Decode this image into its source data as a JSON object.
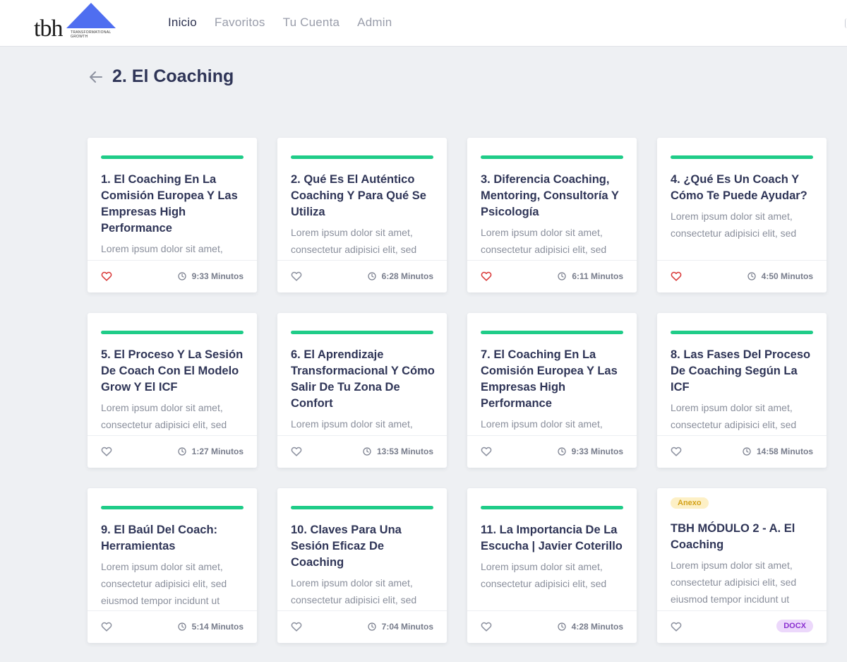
{
  "header": {
    "logo_text": "tbh",
    "logo_tagline": "TRANSFORMATIONAL GROWTH",
    "nav": [
      "Inicio",
      "Favoritos",
      "Tu Cuenta",
      "Admin"
    ]
  },
  "page": {
    "title": "2. El Coaching"
  },
  "colors": {
    "progress": "#1fcc88",
    "heart_active": "#d93838",
    "title": "#2f3557"
  },
  "cards": [
    {
      "title": "1. El Coaching En La Comisión Europea Y Las Empresas High Performance",
      "desc": "Lorem ipsum dolor sit amet,",
      "duration": "9:33 Minutos",
      "favorite": true
    },
    {
      "title": "2. Qué Es El Auténtico Coaching Y Para Qué Se Utiliza",
      "desc": "Lorem ipsum dolor sit amet, consectetur adipisici elit, sed",
      "duration": "6:28 Minutos",
      "favorite": false
    },
    {
      "title": "3. Diferencia Coaching, Mentoring, Consultoría Y Psicología",
      "desc": "Lorem ipsum dolor sit amet, consectetur adipisici elit, sed",
      "duration": "6:11 Minutos",
      "favorite": true
    },
    {
      "title": "4. ¿Qué Es Un Coach Y Cómo Te Puede Ayudar?",
      "desc": "Lorem ipsum dolor sit amet, consectetur adipisici elit, sed",
      "duration": "4:50 Minutos",
      "favorite": true
    },
    {
      "title": "5. El Proceso Y La Sesión De Coach Con El Modelo Grow Y El ICF",
      "desc": "Lorem ipsum dolor sit amet, consectetur adipisici elit, sed",
      "duration": "1:27 Minutos",
      "favorite": false
    },
    {
      "title": "6. El Aprendizaje Transformacional Y Cómo Salir De Tu Zona De Confort",
      "desc": "Lorem ipsum dolor sit amet,",
      "duration": "13:53 Minutos",
      "favorite": false
    },
    {
      "title": "7. El Coaching En La Comisión Europea Y Las Empresas High Performance",
      "desc": "Lorem ipsum dolor sit amet,",
      "duration": "9:33 Minutos",
      "favorite": false
    },
    {
      "title": "8. Las Fases Del Proceso De Coaching Según La ICF",
      "desc": "Lorem ipsum dolor sit amet, consectetur adipisici elit, sed",
      "duration": "14:58 Minutos",
      "favorite": false
    },
    {
      "title": "9. El Baúl Del Coach: Herramientas",
      "desc": "Lorem ipsum dolor sit amet, consectetur adipisici elit, sed eiusmod tempor incidunt ut",
      "duration": "5:14 Minutos",
      "favorite": false
    },
    {
      "title": "10. Claves Para Una Sesión Eficaz De Coaching",
      "desc": "Lorem ipsum dolor sit amet, consectetur adipisici elit, sed",
      "duration": "7:04 Minutos",
      "favorite": false
    },
    {
      "title": "11. La Importancia De La Escucha | Javier Coterillo",
      "desc": "Lorem ipsum dolor sit amet, consectetur adipisici elit, sed",
      "duration": "4:28 Minutos",
      "favorite": false
    },
    {
      "title": "TBH MÓDULO 2 - A. El Coaching",
      "desc": "Lorem ipsum dolor sit amet, consectetur adipisici elit, sed eiusmod tempor incidunt ut",
      "badge": "Anexo",
      "file_type": "DOCX",
      "favorite": false
    }
  ]
}
